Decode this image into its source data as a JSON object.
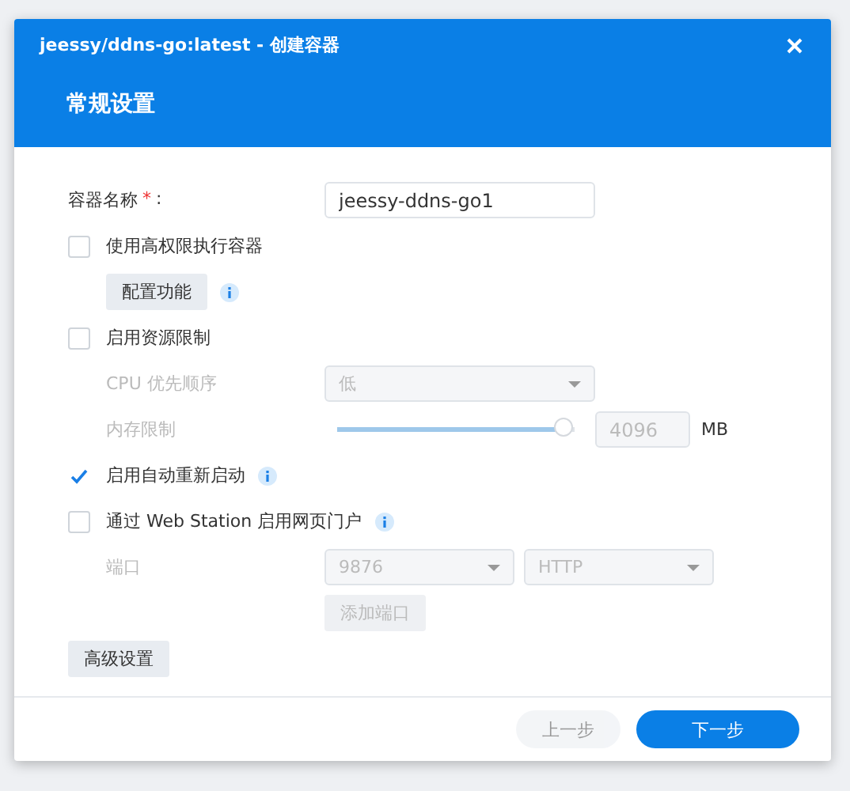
{
  "dialog": {
    "title": "jeessy/ddns-go:latest - 创建容器",
    "section_title": "常规设置"
  },
  "container_name": {
    "label": "容器名称",
    "required_mark": "*",
    "colon": ":",
    "value": "jeessy-ddns-go1"
  },
  "privileged": {
    "label": "使用高权限执行容器",
    "checked": false,
    "configure_button": "配置功能"
  },
  "resource_limit": {
    "label": "启用资源限制",
    "checked": false,
    "cpu_label": "CPU 优先顺序",
    "cpu_value": "低",
    "memory_label": "内存限制",
    "memory": {
      "level": 0.95,
      "value": "4096",
      "unit": "MB"
    }
  },
  "auto_restart": {
    "label": "启用自动重新启动",
    "checked": true
  },
  "web_portal": {
    "label": "通过 Web Station 启用网页门户",
    "checked": false,
    "port_label": "端口",
    "port": "9876",
    "protocol": "HTTP",
    "add_port_button": "添加端口"
  },
  "advanced_button": "高级设置",
  "footer": {
    "buttons": [
      {
        "label": "上一步",
        "kind": "secondary",
        "disabled": true
      },
      {
        "label": "下一步",
        "kind": "primary",
        "disabled": false
      }
    ]
  }
}
